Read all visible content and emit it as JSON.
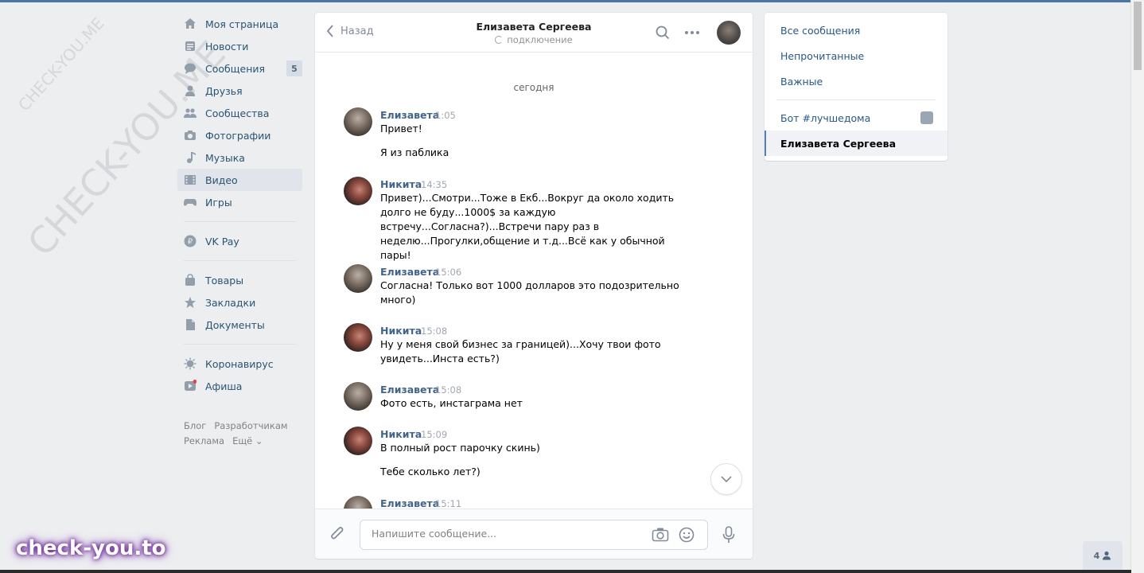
{
  "watermarks": {
    "small": "CHECK-YOU.ME",
    "big": "CHECK-YOU.ME",
    "brand": "check-you.to"
  },
  "nav": {
    "items": [
      {
        "label": "Моя страница",
        "icon": "home-icon"
      },
      {
        "label": "Новости",
        "icon": "news-icon"
      },
      {
        "label": "Сообщения",
        "icon": "messages-icon",
        "badge": "5"
      },
      {
        "label": "Друзья",
        "icon": "friends-icon"
      },
      {
        "label": "Сообщества",
        "icon": "groups-icon"
      },
      {
        "label": "Фотографии",
        "icon": "camera-icon"
      },
      {
        "label": "Музыка",
        "icon": "music-icon"
      },
      {
        "label": "Видео",
        "icon": "video-icon",
        "active": true
      },
      {
        "label": "Игры",
        "icon": "gamepad-icon"
      },
      {
        "label": "VK Pay",
        "icon": "vkpay-icon"
      },
      {
        "label": "Товары",
        "icon": "bag-icon"
      },
      {
        "label": "Закладки",
        "icon": "star-icon"
      },
      {
        "label": "Документы",
        "icon": "document-icon"
      },
      {
        "label": "Коронавирус",
        "icon": "virus-icon"
      },
      {
        "label": "Афиша",
        "icon": "poster-icon"
      }
    ],
    "footer": {
      "blog": "Блог",
      "dev": "Разработчикам",
      "ads": "Реклама",
      "more": "Ещё ⌄"
    }
  },
  "chat": {
    "back_label": "Назад",
    "peer_name": "Елизавета Сергеева",
    "peer_status": "подключение",
    "day_label": "сегодня",
    "messages": [
      {
        "author": "Елизавета",
        "time": "1:05",
        "texts": [
          "Привет!",
          "Я из паблика"
        ]
      },
      {
        "author": "Никита",
        "time": "14:35",
        "texts": [
          "Привет)...Смотри...Тоже в Екб...Вокруг да около ходить долго не буду...1000$ за каждую встречу...Согласна?)...Встречи пару раз в неделю...Прогулки,общение и т.д...Всё как у обычной пары!"
        ]
      },
      {
        "author": "Елизавета",
        "time": "15:06",
        "texts": [
          "Согласна! Только вот 1000 долларов это подозрительно много)"
        ]
      },
      {
        "author": "Никита",
        "time": "15:08",
        "texts": [
          "Ну у меня свой бизнес за границей)...Хочу твои фото увидеть...Инста есть?)"
        ]
      },
      {
        "author": "Елизавета",
        "time": "15:08",
        "texts": [
          "Фото есть, инстаграма нет"
        ]
      },
      {
        "author": "Никита",
        "time": "15:09",
        "texts": [
          "В полный рост парочку скинь)",
          "Тебе сколько лет?)"
        ]
      },
      {
        "author": "Елизавета",
        "time": "15:11",
        "texts": []
      }
    ],
    "composer_placeholder": "Напишите сообщение..."
  },
  "right_panel": {
    "items": [
      "Все сообщения",
      "Непрочитанные",
      "Важные"
    ],
    "conversations": [
      {
        "label": "Бот #лучшедома"
      },
      {
        "label": "Елизавета Сергеева",
        "active": true
      }
    ]
  },
  "online_count": "4"
}
